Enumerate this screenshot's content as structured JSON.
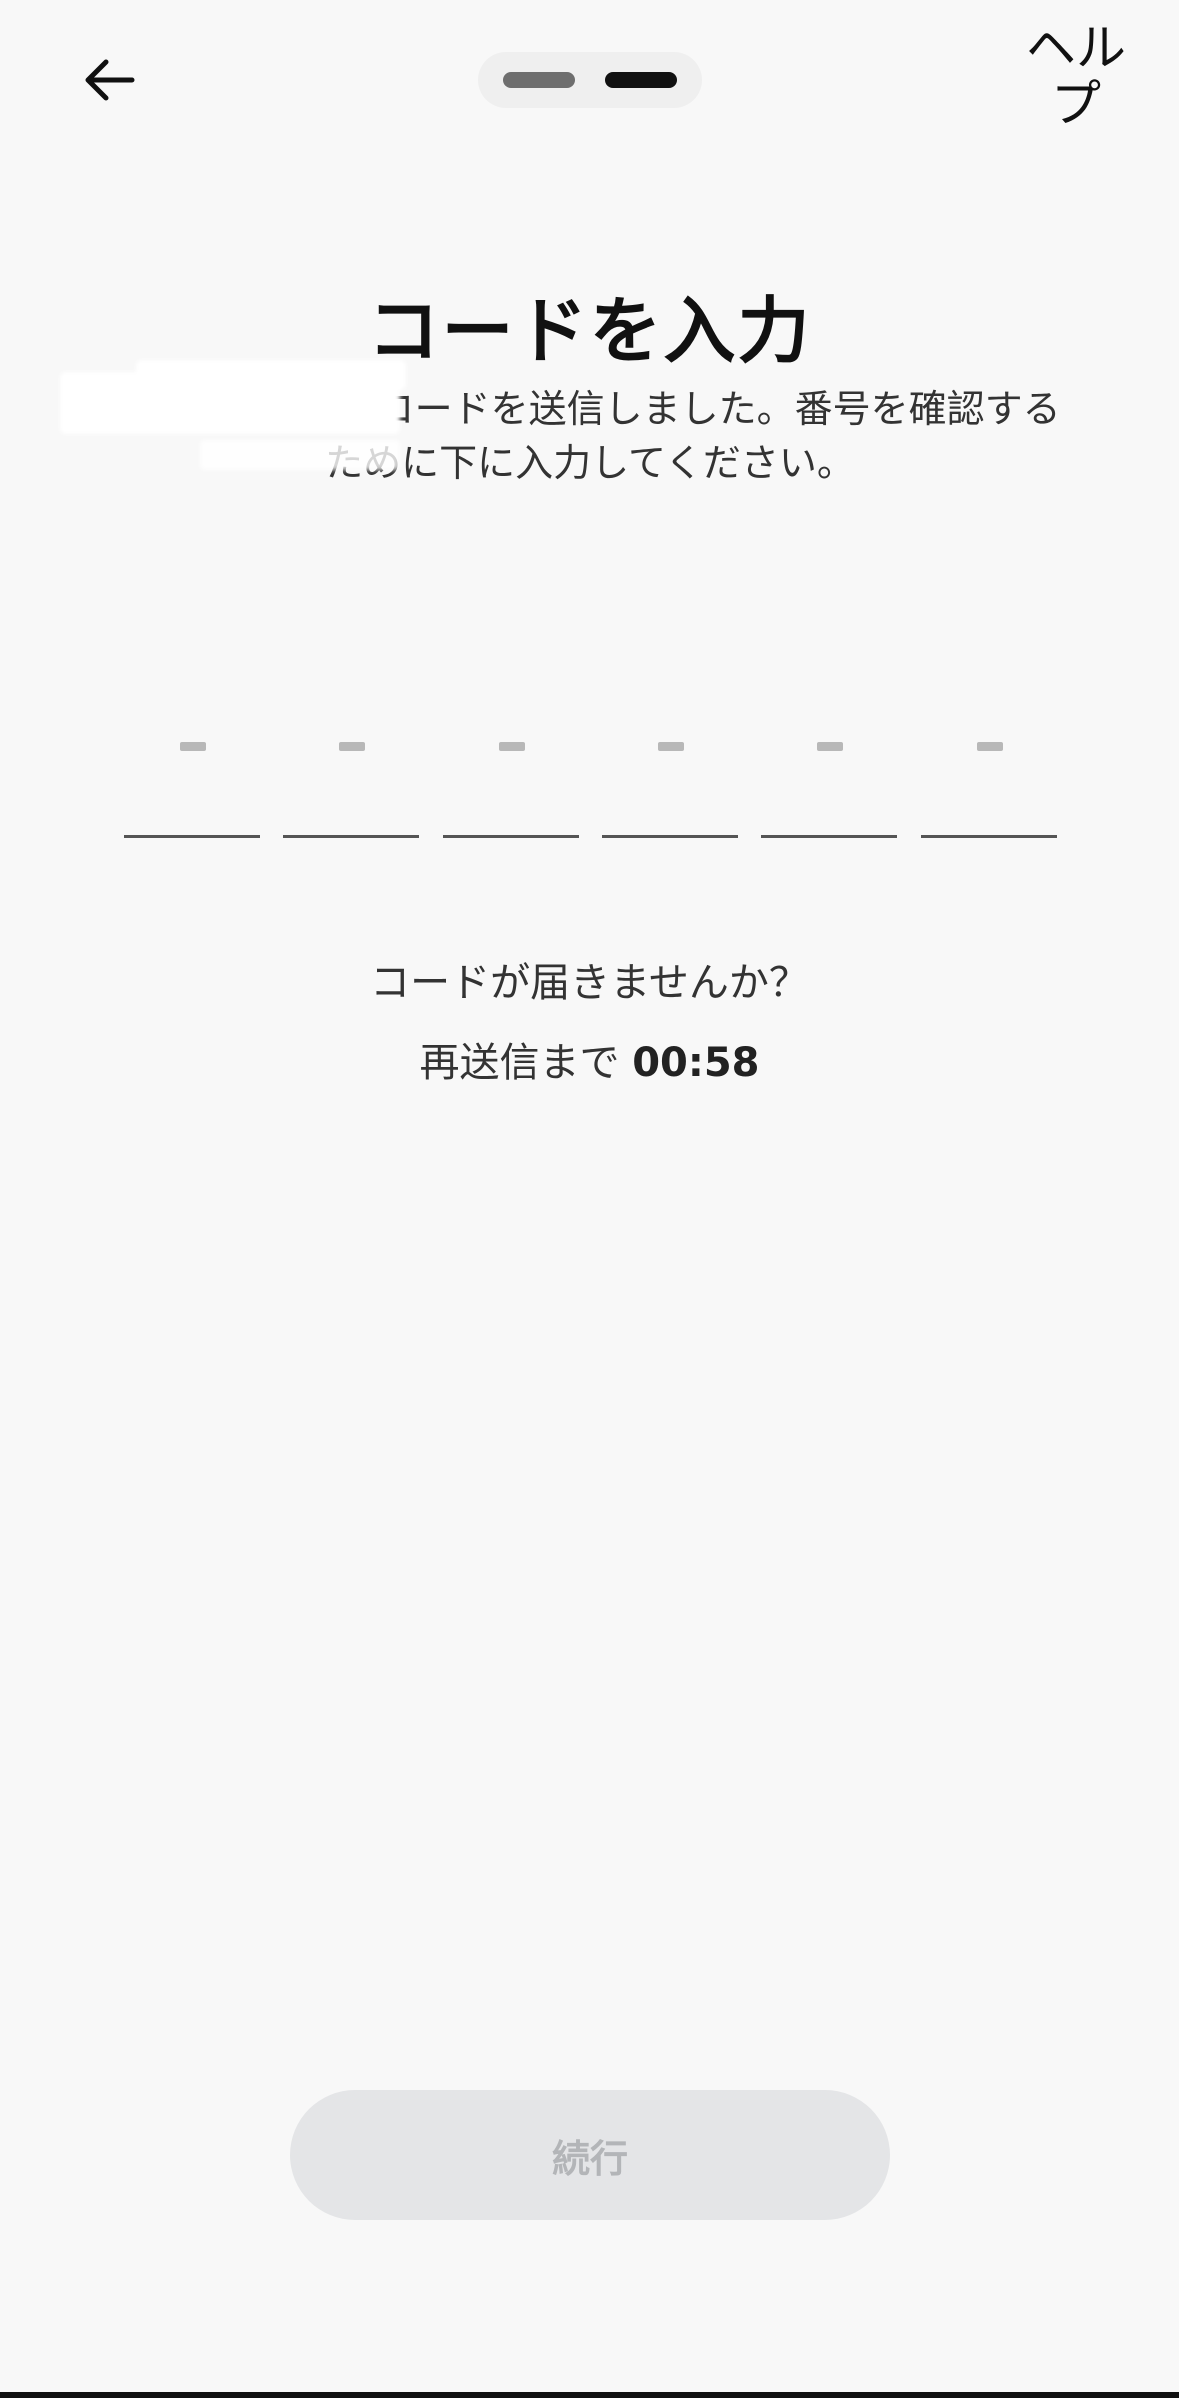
{
  "header": {
    "back_icon": "arrow-left-icon",
    "help_label": "ヘルプ",
    "steps_total": 2,
    "steps_active": 2
  },
  "main": {
    "title": "コードを入力",
    "description": "にSMSで6桁のコードを送信しました。番号を確認するために下に入力してください。",
    "code_placeholders": [
      "–",
      "–",
      "–",
      "–",
      "–",
      "–"
    ],
    "no_code_text": "コードが届きませんか？",
    "resend_prefix": "再送信まで",
    "resend_timer": "00:58"
  },
  "footer": {
    "continue_label": "続行"
  },
  "colors": {
    "background": "#f8f8f8",
    "text": "#111111",
    "button_disabled_bg": "#e4e5e7",
    "button_disabled_text": "#b3b5b8"
  }
}
